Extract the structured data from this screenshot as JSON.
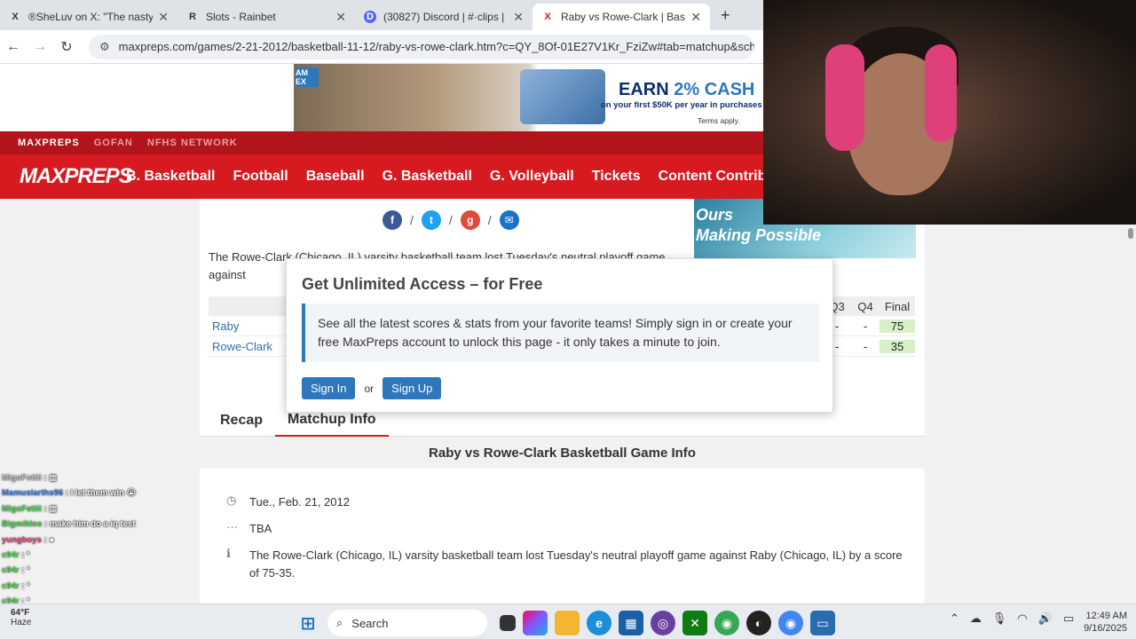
{
  "browser": {
    "tabs": [
      {
        "title": "®SheLuv on X: \"The nasty nerd",
        "fav": "X"
      },
      {
        "title": "Slots - Rainbet",
        "fav": "R"
      },
      {
        "title": "(30827) Discord | #·clips | D",
        "fav": "D"
      },
      {
        "title": "Raby vs Rowe-Clark | Basketball",
        "fav": "X"
      }
    ],
    "new_tab": "+",
    "url": "maxpreps.com/games/2-21-2012/basketball-11-12/raby-vs-rowe-clark.htm?c=QY_8Of-01E27V1Kr_FziZw#tab=matchup&schoolid="
  },
  "ad": {
    "badge": "AM EX",
    "headline_a": "EARN ",
    "headline_b": "2% CASH",
    "sub": "on your first $50K per year in purchases",
    "terms": "Terms apply."
  },
  "topnav": {
    "brand": "MAXPREPS",
    "links": [
      "GOFAN",
      "NFHS NETWORK"
    ]
  },
  "mainnav": {
    "logo": "MAXPREPS",
    "items": [
      "B. Basketball",
      "Football",
      "Baseball",
      "G. Basketball",
      "G. Volleyball",
      "Tickets",
      "Content Contribut"
    ]
  },
  "page": {
    "intro": "The Rowe-Clark (Chicago, IL) varsity basketball team lost Tuesday's neutral playoff game against",
    "side_text_1": "Ours",
    "side_text_2": "Making Possible",
    "score": {
      "headers": [
        "Q3",
        "Q4",
        "Final"
      ],
      "rows": [
        {
          "team": "Raby",
          "q3": "-",
          "q4": "-",
          "final": "75"
        },
        {
          "team": "Rowe-Clark",
          "q3": "-",
          "q4": "-",
          "final": "35"
        }
      ]
    },
    "tabs": [
      "Recap",
      "Matchup Info"
    ],
    "section_title": "Raby vs Rowe-Clark Basketball Game Info",
    "date": "Tue., Feb. 21, 2012",
    "time": "TBA",
    "summary": "The Rowe-Clark (Chicago, IL) varsity basketball team lost Tuesday's neutral playoff game against Raby (Chicago, IL) by a score of 75-35."
  },
  "modal": {
    "title": "Get Unlimited Access – for Free",
    "message": "See all the latest scores & stats from your favorite teams! Simply sign in or create your free MaxPreps account to unlock this page - it only takes a minute to join.",
    "sign_in": "Sign In",
    "or": "or",
    "sign_up": "Sign Up"
  },
  "chat": [
    {
      "user": "MigoFettii",
      "msg": "",
      "style": "g"
    },
    {
      "user": "Mamuslarths96",
      "msg": "i let them win 😭",
      "style": "b"
    },
    {
      "user": "MigoFettii",
      "msg": "",
      "style": ""
    },
    {
      "user": "Bigmiklos",
      "msg": "make him do a iq test",
      "style": ""
    },
    {
      "user": "yungboys",
      "msg": "",
      "style": ""
    },
    {
      "user": "c94r",
      "msg": "",
      "style": ""
    },
    {
      "user": "c94r",
      "msg": "",
      "style": ""
    },
    {
      "user": "c94r",
      "msg": "",
      "style": ""
    },
    {
      "user": "c94r",
      "msg": "",
      "style": ""
    },
    {
      "user": "c94r",
      "msg": "",
      "style": ""
    }
  ],
  "taskbar": {
    "weather_temp": "64°F",
    "weather_desc": "Haze",
    "search_placeholder": "Search",
    "time": "12:49 AM",
    "date": "9/16/2025"
  },
  "colors": {
    "brand_red": "#d71920",
    "dark_red": "#b2141b",
    "link_blue": "#2f6ea8",
    "button_blue": "#2e77bb"
  }
}
